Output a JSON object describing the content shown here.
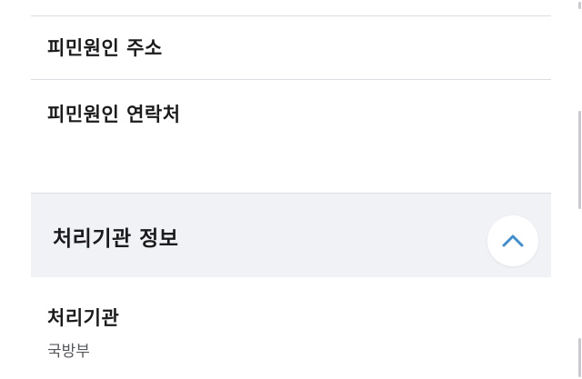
{
  "complainant": {
    "address_label": "피민원인 주소",
    "contact_label": "피민원인 연락처"
  },
  "section": {
    "title": "처리기관 정보",
    "toggle_icon": "chevron-up-icon",
    "accent_color": "#3d8fd1",
    "fields": [
      {
        "label": "처리기관",
        "value": "국방부"
      }
    ]
  }
}
